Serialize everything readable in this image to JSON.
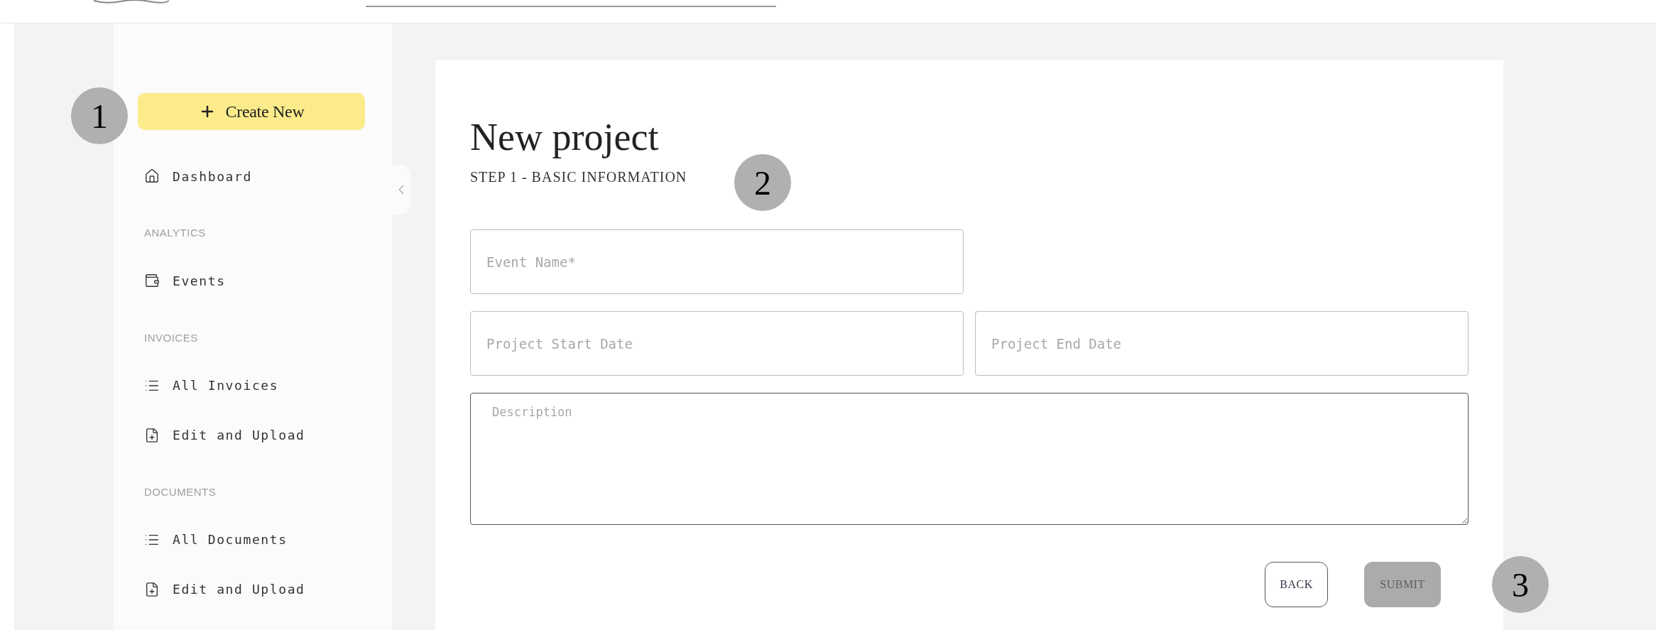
{
  "annotations": [
    {
      "label": "1"
    },
    {
      "label": "2"
    },
    {
      "label": "3"
    }
  ],
  "sidebar": {
    "create_button": {
      "label": "Create New"
    },
    "sections": [
      {
        "items": [
          {
            "label": "Dashboard",
            "kind": "home"
          }
        ]
      },
      {
        "heading": "ANALYTICS",
        "items": [
          {
            "label": "Events",
            "kind": "wallet"
          }
        ]
      },
      {
        "heading": "INVOICES",
        "items": [
          {
            "label": "All Invoices",
            "kind": "list"
          },
          {
            "label": "Edit and Upload",
            "kind": "file"
          }
        ]
      },
      {
        "heading": "DOCUMENTS",
        "items": [
          {
            "label": "All Documents",
            "kind": "list"
          },
          {
            "label": "Edit and Upload",
            "kind": "file"
          }
        ]
      }
    ]
  },
  "form": {
    "title": "New project",
    "step": "STEP 1 - BASIC INFORMATION",
    "rows": [
      [
        {
          "placeholder": "Event Name*"
        }
      ],
      [
        {
          "placeholder": "Project Start Date"
        },
        {
          "placeholder": "Project End Date"
        }
      ]
    ],
    "description": {
      "placeholder": "Description"
    },
    "buttons": [
      {
        "label": "BACK",
        "disabled": false
      },
      {
        "label": "SUBMIT",
        "disabled": true
      }
    ]
  }
}
